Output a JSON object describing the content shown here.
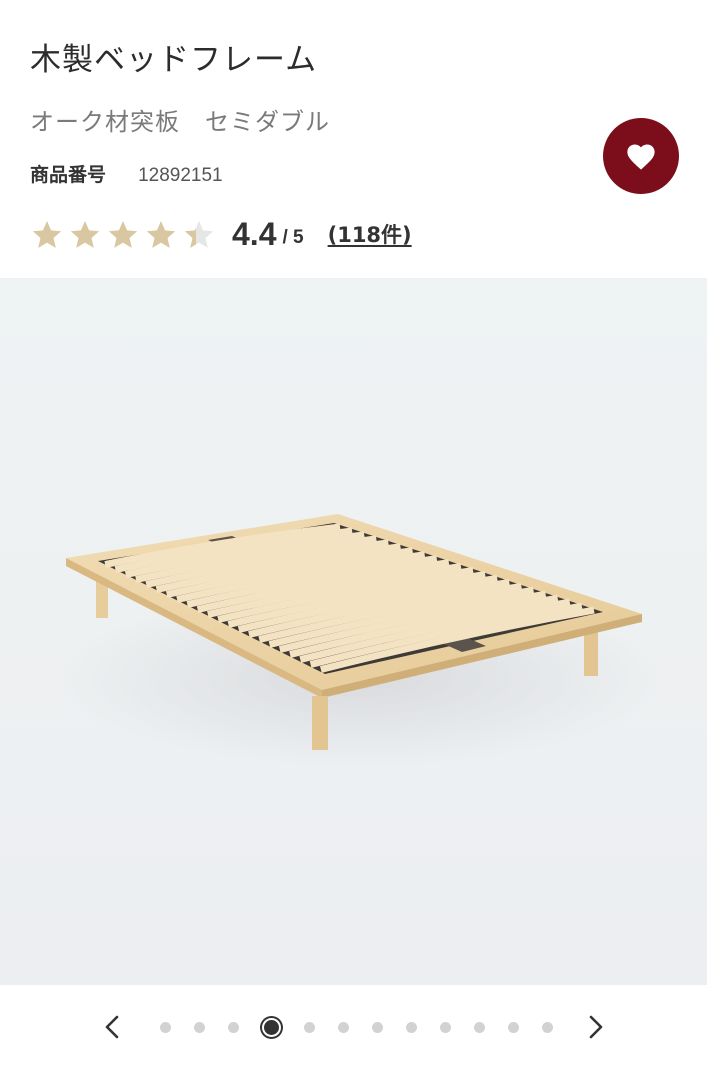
{
  "product": {
    "title": "木製ベッドフレーム",
    "subtitle": "オーク材突板　セミダブル",
    "number_label": "商品番号",
    "number": "12892151"
  },
  "favorite": {
    "icon": "heart-icon",
    "color": "#7c0d1a"
  },
  "rating": {
    "score": "4.4",
    "out_of": "/ 5",
    "value": 4.4,
    "max": 5,
    "reviews": "(118件)",
    "star_color": "#d8c7a0",
    "empty_color": "#e6e6e6"
  },
  "image": {
    "subject": "bed-frame-photo"
  },
  "pager": {
    "total": 12,
    "current": 4,
    "prev_icon": "chevron-left-icon",
    "next_icon": "chevron-right-icon"
  }
}
